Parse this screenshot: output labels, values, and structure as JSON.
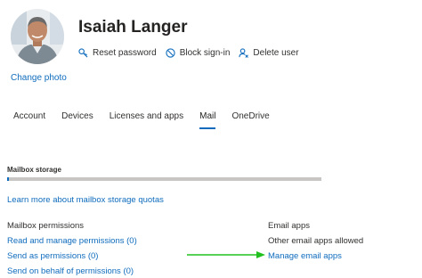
{
  "user": {
    "name": "Isaiah Langer",
    "change_photo_label": "Change photo"
  },
  "actions": [
    {
      "icon": "key-icon",
      "label": "Reset password"
    },
    {
      "icon": "block-icon",
      "label": "Block sign-in"
    },
    {
      "icon": "delete-user-icon",
      "label": "Delete user"
    }
  ],
  "tabs": [
    {
      "label": "Account",
      "active": false
    },
    {
      "label": "Devices",
      "active": false
    },
    {
      "label": "Licenses and apps",
      "active": false
    },
    {
      "label": "Mail",
      "active": true
    },
    {
      "label": "OneDrive",
      "active": false
    }
  ],
  "mailbox_storage": {
    "label": "Mailbox storage",
    "used_fraction": 0.005,
    "learn_more_label": "Learn more about mailbox storage quotas"
  },
  "mailbox_permissions": {
    "heading": "Mailbox permissions",
    "links": [
      "Read and manage permissions (0)",
      "Send as permissions (0)",
      "Send on behalf of permissions (0)"
    ]
  },
  "email_apps": {
    "heading": "Email apps",
    "status": "Other email apps allowed",
    "manage_label": "Manage email apps"
  },
  "colors": {
    "accent": "#0f6cbd",
    "arrow": "#22c01e"
  }
}
